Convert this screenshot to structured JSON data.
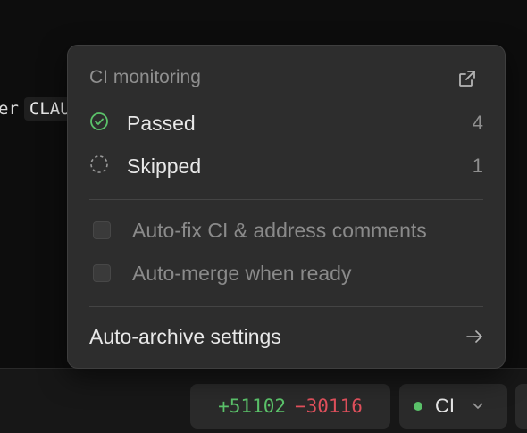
{
  "editor": {
    "text_before": "er",
    "code_text": "CLAU"
  },
  "popover": {
    "title": "CI monitoring",
    "checks": [
      {
        "label": "Passed",
        "count": "4",
        "status": "passed",
        "icon": "check-circle-icon"
      },
      {
        "label": "Skipped",
        "count": "1",
        "status": "skipped",
        "icon": "dashed-circle-icon"
      }
    ],
    "options": [
      {
        "label": "Auto-fix CI & address comments",
        "checked": false
      },
      {
        "label": "Auto-merge when ready",
        "checked": false
      }
    ],
    "settings_label": "Auto-archive settings"
  },
  "bottom_bar": {
    "additions": "+51102",
    "deletions": "−30116",
    "ci_label": "CI",
    "ci_status_color": "#5bc26a"
  },
  "colors": {
    "passed": "#5bc26a",
    "additions": "#5bc26a",
    "deletions": "#e0505c",
    "popover_bg": "#2d2d2d"
  }
}
